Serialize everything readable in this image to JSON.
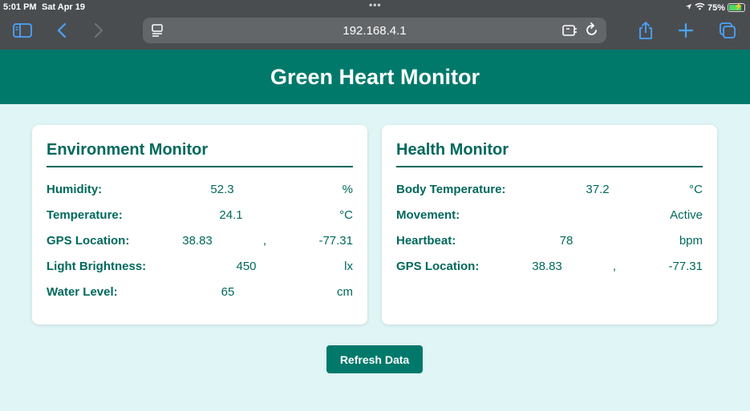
{
  "status_bar": {
    "time": "5:01 PM",
    "date": "Sat Apr 19",
    "battery": "75%",
    "battery_level": 0.75
  },
  "browser": {
    "url": "192.168.4.1"
  },
  "header": {
    "title": "Green Heart Monitor"
  },
  "environment": {
    "title": "Environment Monitor",
    "humidity": {
      "label": "Humidity:",
      "value": "52.3",
      "unit": "%"
    },
    "temperature": {
      "label": "Temperature:",
      "value": "24.1",
      "unit": "°C"
    },
    "gps": {
      "label": "GPS Location:",
      "lat": "38.83",
      "sep": ",",
      "lon": "-77.31"
    },
    "light": {
      "label": "Light Brightness:",
      "value": "450",
      "unit": "lx"
    },
    "water": {
      "label": "Water Level:",
      "value": "65",
      "unit": "cm"
    }
  },
  "health": {
    "title": "Health Monitor",
    "body_temp": {
      "label": "Body Temperature:",
      "value": "37.2",
      "unit": "°C"
    },
    "movement": {
      "label": "Movement:",
      "value": "Active"
    },
    "heartbeat": {
      "label": "Heartbeat:",
      "value": "78",
      "unit": "bpm"
    },
    "gps": {
      "label": "GPS Location:",
      "lat": "38.83",
      "sep": ",",
      "lon": "-77.31"
    }
  },
  "actions": {
    "refresh_label": "Refresh Data"
  }
}
